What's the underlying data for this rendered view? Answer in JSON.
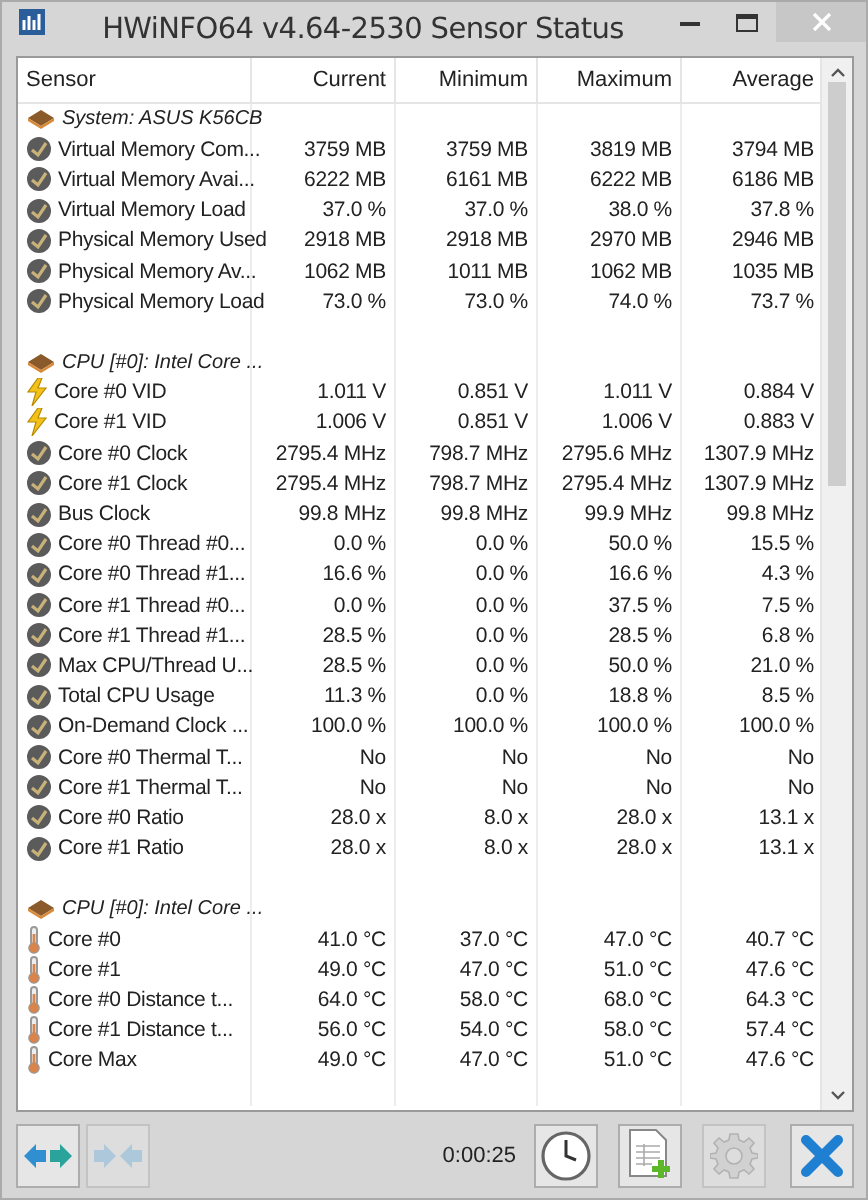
{
  "window": {
    "title": "HWiNFO64 v4.64-2530 Sensor Status"
  },
  "columns": [
    "Sensor",
    "Current",
    "Minimum",
    "Maximum",
    "Average"
  ],
  "groups": [
    {
      "label": "System: ASUS K56CB",
      "rows": [
        {
          "kind": "gauge",
          "name": "Virtual Memory Com...",
          "values": [
            "3759 MB",
            "3759 MB",
            "3819 MB",
            "3794 MB"
          ]
        },
        {
          "kind": "gauge",
          "name": "Virtual Memory Avai...",
          "values": [
            "6222 MB",
            "6161 MB",
            "6222 MB",
            "6186 MB"
          ]
        },
        {
          "kind": "gauge",
          "name": "Virtual Memory Load",
          "values": [
            "37.0 %",
            "37.0 %",
            "38.0 %",
            "37.8 %"
          ]
        },
        {
          "kind": "gauge",
          "name": "Physical Memory Used",
          "values": [
            "2918 MB",
            "2918 MB",
            "2970 MB",
            "2946 MB"
          ]
        },
        {
          "kind": "gauge",
          "name": "Physical Memory Av...",
          "values": [
            "1062 MB",
            "1011 MB",
            "1062 MB",
            "1035 MB"
          ]
        },
        {
          "kind": "gauge",
          "name": "Physical Memory Load",
          "values": [
            "73.0 %",
            "73.0 %",
            "74.0 %",
            "73.7 %"
          ]
        }
      ]
    },
    {
      "label": "CPU [#0]: Intel Core ...",
      "rows": [
        {
          "kind": "voltage",
          "name": "Core #0 VID",
          "values": [
            "1.011 V",
            "0.851 V",
            "1.011 V",
            "0.884 V"
          ]
        },
        {
          "kind": "voltage",
          "name": "Core #1 VID",
          "values": [
            "1.006 V",
            "0.851 V",
            "1.006 V",
            "0.883 V"
          ]
        },
        {
          "kind": "gauge",
          "name": "Core #0 Clock",
          "values": [
            "2795.4 MHz",
            "798.7 MHz",
            "2795.6 MHz",
            "1307.9 MHz"
          ]
        },
        {
          "kind": "gauge",
          "name": "Core #1 Clock",
          "values": [
            "2795.4 MHz",
            "798.7 MHz",
            "2795.4 MHz",
            "1307.9 MHz"
          ]
        },
        {
          "kind": "gauge",
          "name": "Bus Clock",
          "values": [
            "99.8 MHz",
            "99.8 MHz",
            "99.9 MHz",
            "99.8 MHz"
          ]
        },
        {
          "kind": "gauge",
          "name": "Core #0 Thread #0...",
          "values": [
            "0.0 %",
            "0.0 %",
            "50.0 %",
            "15.5 %"
          ]
        },
        {
          "kind": "gauge",
          "name": "Core #0 Thread #1...",
          "values": [
            "16.6 %",
            "0.0 %",
            "16.6 %",
            "4.3 %"
          ]
        },
        {
          "kind": "gauge",
          "name": "Core #1 Thread #0...",
          "values": [
            "0.0 %",
            "0.0 %",
            "37.5 %",
            "7.5 %"
          ]
        },
        {
          "kind": "gauge",
          "name": "Core #1 Thread #1...",
          "values": [
            "28.5 %",
            "0.0 %",
            "28.5 %",
            "6.8 %"
          ]
        },
        {
          "kind": "gauge",
          "name": "Max CPU/Thread U...",
          "values": [
            "28.5 %",
            "0.0 %",
            "50.0 %",
            "21.0 %"
          ]
        },
        {
          "kind": "gauge",
          "name": "Total CPU Usage",
          "values": [
            "11.3 %",
            "0.0 %",
            "18.8 %",
            "8.5 %"
          ]
        },
        {
          "kind": "gauge",
          "name": "On-Demand Clock ...",
          "values": [
            "100.0 %",
            "100.0 %",
            "100.0 %",
            "100.0 %"
          ]
        },
        {
          "kind": "gauge",
          "name": "Core #0 Thermal T...",
          "values": [
            "No",
            "No",
            "No",
            "No"
          ]
        },
        {
          "kind": "gauge",
          "name": "Core #1 Thermal T...",
          "values": [
            "No",
            "No",
            "No",
            "No"
          ]
        },
        {
          "kind": "gauge",
          "name": "Core #0 Ratio",
          "values": [
            "28.0 x",
            "8.0 x",
            "28.0 x",
            "13.1 x"
          ]
        },
        {
          "kind": "gauge",
          "name": "Core #1 Ratio",
          "values": [
            "28.0 x",
            "8.0 x",
            "28.0 x",
            "13.1 x"
          ]
        }
      ]
    },
    {
      "label": "CPU [#0]: Intel Core ...",
      "rows": [
        {
          "kind": "temperature",
          "name": "Core #0",
          "values": [
            "41.0 °C",
            "37.0 °C",
            "47.0 °C",
            "40.7 °C"
          ]
        },
        {
          "kind": "temperature",
          "name": "Core #1",
          "values": [
            "49.0 °C",
            "47.0 °C",
            "51.0 °C",
            "47.6 °C"
          ]
        },
        {
          "kind": "temperature",
          "name": "Core #0 Distance t...",
          "values": [
            "64.0 °C",
            "58.0 °C",
            "68.0 °C",
            "64.3 °C"
          ]
        },
        {
          "kind": "temperature",
          "name": "Core #1 Distance t...",
          "values": [
            "56.0 °C",
            "54.0 °C",
            "58.0 °C",
            "57.4 °C"
          ]
        },
        {
          "kind": "temperature",
          "name": "Core Max",
          "values": [
            "49.0 °C",
            "47.0 °C",
            "51.0 °C",
            "47.6 °C"
          ]
        }
      ]
    }
  ],
  "toolbar": {
    "elapsed": "0:00:25",
    "buttons": [
      {
        "kind": "expand",
        "disabled": false
      },
      {
        "kind": "collapse",
        "disabled": true
      },
      {
        "kind": "clock",
        "disabled": false
      },
      {
        "kind": "report",
        "disabled": false
      },
      {
        "kind": "settings",
        "disabled": true
      },
      {
        "kind": "close",
        "disabled": false
      }
    ]
  }
}
